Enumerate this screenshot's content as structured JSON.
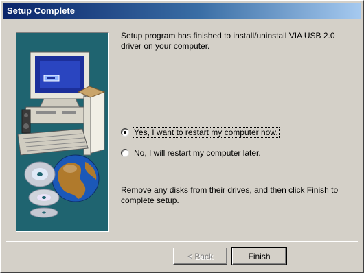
{
  "window": {
    "title": "Setup Complete"
  },
  "content": {
    "intro_text": "Setup program has finished to install/uninstall VIA USB 2.0 driver on your computer.",
    "options": [
      {
        "label": "Yes, I want to restart my computer now.",
        "selected": true
      },
      {
        "label": "No, I will restart my computer later.",
        "selected": false
      }
    ],
    "outro_text": "Remove any disks from their drives, and then click Finish to complete setup."
  },
  "buttons": {
    "back_label": "< Back",
    "finish_label": "Finish"
  },
  "colors": {
    "dialog_face": "#d4d0c8",
    "title_start": "#0a246a",
    "title_end": "#a6caf0",
    "picture_bg": "#1f6470"
  }
}
